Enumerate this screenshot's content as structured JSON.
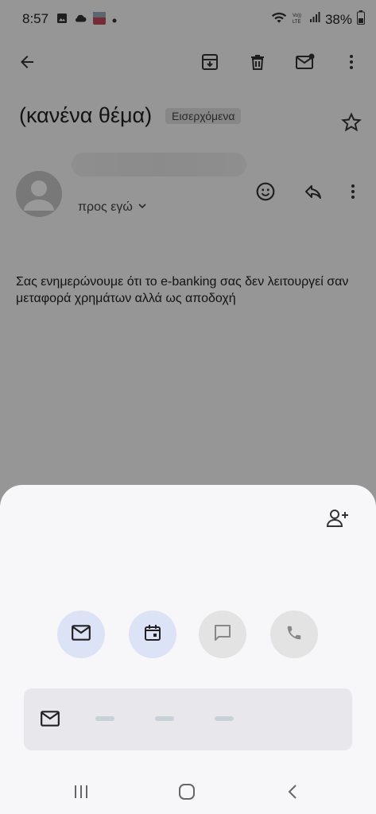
{
  "status_bar": {
    "time": "8:57",
    "battery": "38%",
    "icons": [
      "gallery-icon",
      "cloud-icon",
      "app-notification-icon",
      "dot-icon",
      "wifi-icon",
      "volte-icon",
      "signal-icon",
      "battery-icon"
    ]
  },
  "toolbar": {
    "icons": [
      "back-arrow-icon",
      "archive-icon",
      "delete-icon",
      "mark-unread-icon",
      "more-vert-icon"
    ]
  },
  "email": {
    "subject": "(κανένα θέμα)",
    "label": "Εισερχόμενα",
    "recipient": "προς εγώ",
    "body": "Σας ενημερώνουμε ότι το e-banking σας δεν λειτουργεί σαν μεταφορά χρημάτων αλλά ως αποδοχή"
  },
  "sender_actions": {
    "icons": [
      "emoji-react-icon",
      "reply-icon",
      "more-vert-icon"
    ]
  },
  "contact_sheet": {
    "add_contact_icon": "person-add-icon",
    "actions": [
      {
        "icon": "mail-icon",
        "state": "active"
      },
      {
        "icon": "calendar-icon",
        "state": "active"
      },
      {
        "icon": "chat-icon",
        "state": "disabled"
      },
      {
        "icon": "phone-icon",
        "state": "disabled"
      }
    ],
    "email_row_icon": "mail-icon"
  },
  "nav_bar": {
    "buttons": [
      "recents-icon",
      "home-icon",
      "back-icon"
    ]
  },
  "colors": {
    "scrim": "#000000",
    "action_active_bg": "#dde3f7",
    "action_disabled_bg": "#e3e3e3",
    "sheet_bg": "#f7f7fa"
  }
}
